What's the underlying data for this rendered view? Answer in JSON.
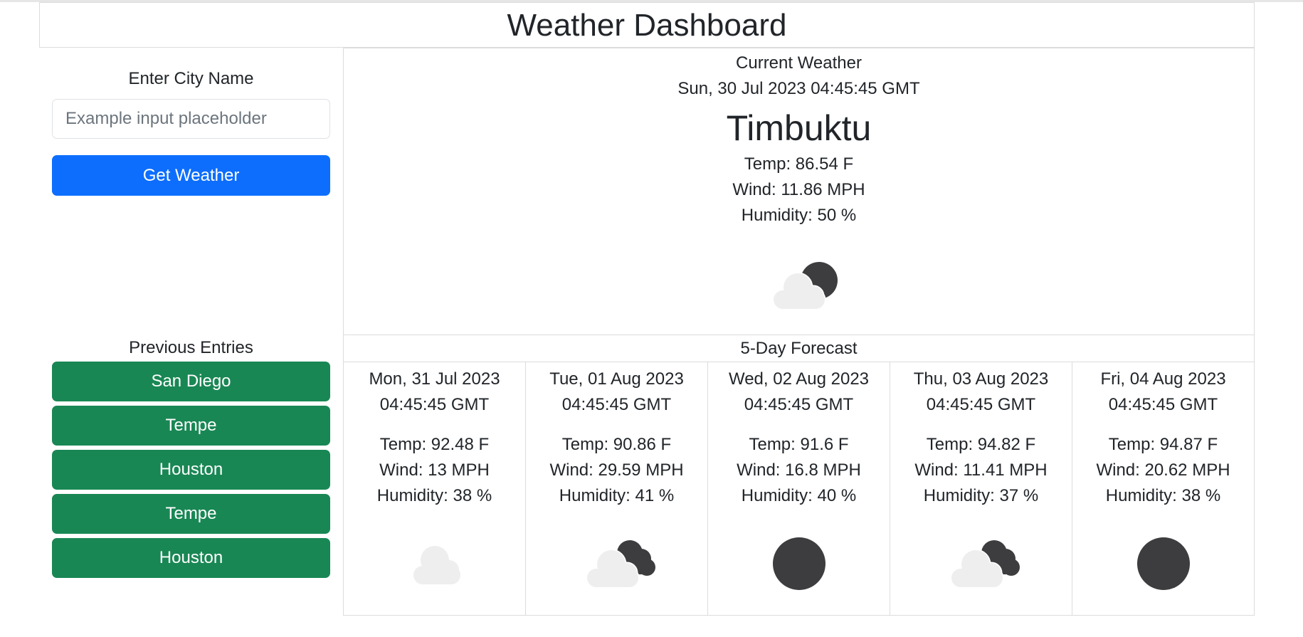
{
  "app": {
    "title": "Weather Dashboard"
  },
  "search": {
    "label": "Enter City Name",
    "placeholder": "Example input placeholder",
    "value": "",
    "button_label": "Get Weather"
  },
  "history": {
    "label": "Previous Entries",
    "items": [
      "San Diego",
      "Tempe",
      "Houston",
      "Tempe",
      "Houston"
    ]
  },
  "current": {
    "heading": "Current Weather",
    "datetime": "Sun, 30 Jul 2023 04:45:45 GMT",
    "city": "Timbuktu",
    "temp": "Temp: 86.54 F",
    "wind": "Wind: 11.86 MPH",
    "humidity": "Humidity: 50 %",
    "icon": "partly-cloudy-night-icon"
  },
  "forecast": {
    "heading": "5-Day Forecast",
    "days": [
      {
        "date": "Mon, 31 Jul 2023\n04:45:45 GMT",
        "temp": "Temp: 92.48 F",
        "wind": "Wind: 13 MPH",
        "humidity": "Humidity: 38 %",
        "icon": "cloud-icon"
      },
      {
        "date": "Tue, 01 Aug 2023\n04:45:45 GMT",
        "temp": "Temp: 90.86 F",
        "wind": "Wind: 29.59 MPH",
        "humidity": "Humidity: 41 %",
        "icon": "broken-clouds-icon"
      },
      {
        "date": "Wed, 02 Aug 2023\n04:45:45 GMT",
        "temp": "Temp: 91.6 F",
        "wind": "Wind: 16.8 MPH",
        "humidity": "Humidity: 40 %",
        "icon": "clear-night-icon"
      },
      {
        "date": "Thu, 03 Aug 2023\n04:45:45 GMT",
        "temp": "Temp: 94.82 F",
        "wind": "Wind: 11.41 MPH",
        "humidity": "Humidity: 37 %",
        "icon": "broken-clouds-icon"
      },
      {
        "date": "Fri, 04 Aug 2023\n04:45:45 GMT",
        "temp": "Temp: 94.87 F",
        "wind": "Wind: 20.62 MPH",
        "humidity": "Humidity: 38 %",
        "icon": "clear-night-icon"
      }
    ]
  },
  "colors": {
    "primary_button": "#0d6efd",
    "history_button": "#198754",
    "dark_icon": "#3d3d3f",
    "light_cloud": "#eeeeee"
  }
}
